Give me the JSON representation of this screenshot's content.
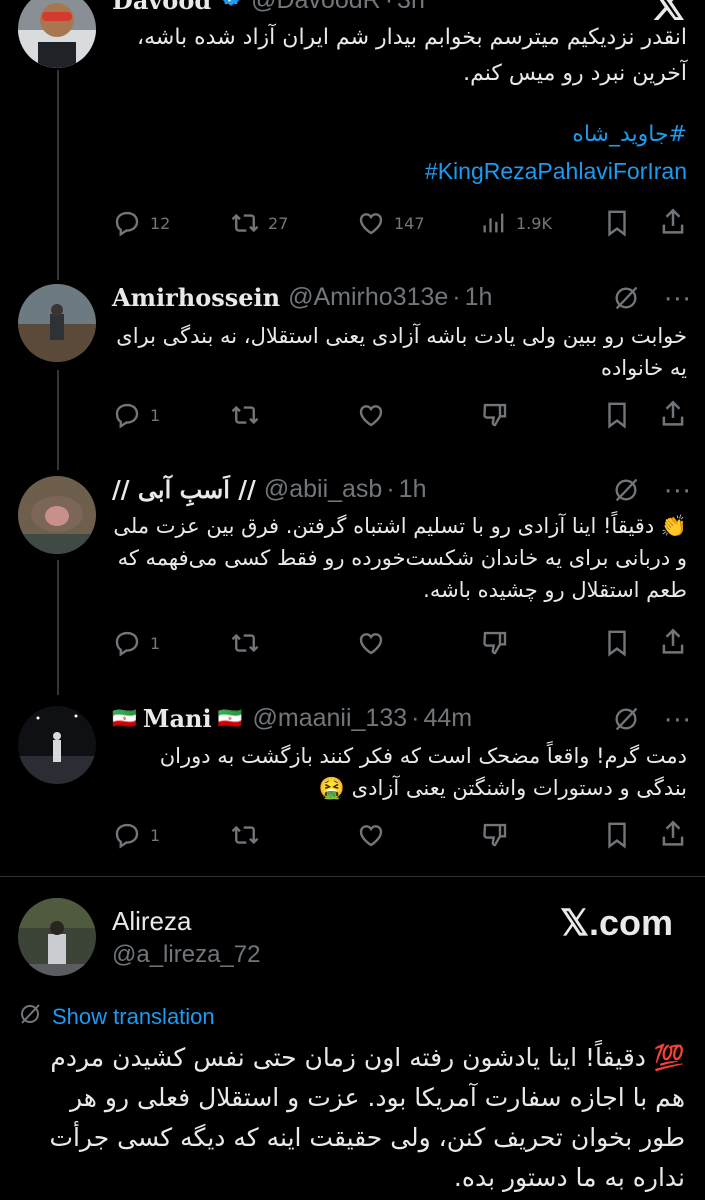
{
  "tweets": [
    {
      "name": "Davood",
      "handle": "@DavoodR",
      "time": "3h",
      "body": "انقدر نزدیکیم میترسم بخوابم بیدار شم ایران آزاد شده باشه، آخرین نبرد رو میس کنم.",
      "hashtags": [
        "#جاوید_شاه",
        "#KingRezaPahlaviForIran"
      ],
      "stats": {
        "replies": "12",
        "retweets": "27",
        "likes": "147",
        "views": "1.9K"
      }
    },
    {
      "name": "Amirhossein",
      "handle": "@Amirho313e",
      "time": "1h",
      "body": "خوابت رو ببین ولی یادت باشه آزادی یعنی استقلال، نه بندگی برای یه خانواده",
      "stats": {
        "replies": "1"
      }
    },
    {
      "name": "// اَسبِ آبی //",
      "handle": "@abii_asb",
      "time": "1h",
      "body": "👏 دقیقاً! اینا آزادی رو با تسلیم اشتباه گرفتن. فرق بین عزت ملی و دربانی برای یه خاندان شکست‌خورده رو فقط کسی می‌فهمه که طعم استقلال رو چشیده باشه.",
      "stats": {
        "replies": "1"
      }
    },
    {
      "name": "Mani",
      "flag": "🇮🇷",
      "handle": "@maanii_133",
      "time": "44m",
      "body": "دمت گرم! واقعاً مضحک است که فکر کنند بازگشت به دوران بندگی و دستورات واشنگتن یعنی آزادی 🤮",
      "stats": {
        "replies": "1"
      }
    }
  ],
  "separator": "·",
  "more": "···",
  "card": {
    "name": "Alireza",
    "handle": "@a_lireza_72",
    "brand": "𝕏.com",
    "show_translation": "Show translation",
    "body": "💯 دقیقاً! اینا یادشون رفته اون زمان حتی نفس کشیدن مردم هم با اجازه سفارت آمریکا بود. عزت و استقلال فعلی رو هر طور بخوان تحریف کنن، ولی حقیقت اینه که دیگه کسی جرأت نداره به ما دستور بده."
  },
  "colors": {
    "background": "#000000",
    "text": "#e7e9ea",
    "muted": "#71767b",
    "accent": "#1d9bf0"
  },
  "icons": [
    "verified-icon",
    "x-logo-icon",
    "reply-icon",
    "retweet-icon",
    "like-icon",
    "views-icon",
    "bookmark-icon",
    "share-icon",
    "grok-icon",
    "more-icon",
    "dislike-icon",
    "translate-icon"
  ]
}
